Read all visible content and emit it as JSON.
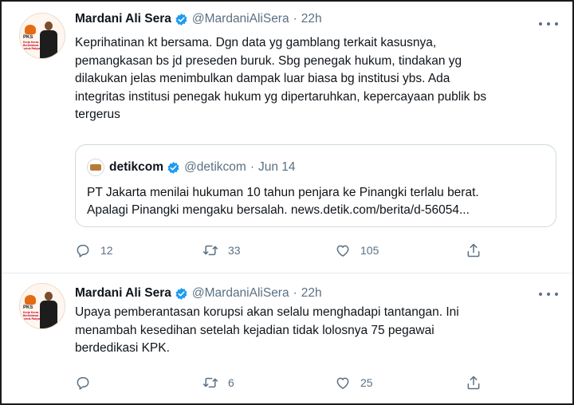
{
  "tweets": [
    {
      "author": {
        "name": "Mardani Ali Sera",
        "handle": "@MardaniAliSera",
        "time": "22h"
      },
      "avatar_text": [
        "PKS",
        "Kerja Keras Berkhidmat untuk Rakyat"
      ],
      "text": "Keprihatinan kt bersama. Dgn data yg gamblang terkait kasusnya,\npemangkasan bs jd preseden buruk. Sbg penegak hukum, tindakan yg\ndilakukan jelas menimbulkan dampak luar biasa bg institusi ybs. Ada\nintegritas institusi penegak hukum yg dipertaruhkan, kepercayaan publik bs\ntergerus",
      "quote": {
        "name": "detikcom",
        "handle": "@detikcom",
        "date": "Jun 14",
        "text": "PT Jakarta menilai hukuman 10 tahun penjara ke Pinangki terlalu berat.\nApalagi Pinangki mengaku bersalah. news.detik.com/berita/d-56054..."
      },
      "actions": {
        "replies": "12",
        "retweets": "33",
        "likes": "105"
      }
    },
    {
      "author": {
        "name": "Mardani Ali Sera",
        "handle": "@MardaniAliSera",
        "time": "22h"
      },
      "avatar_text": [
        "PKS",
        "Kerja Keras Berkhidmat untuk Rakyat"
      ],
      "text": "Upaya pemberantasan korupsi akan selalu menghadapi tantangan. Ini\nmenambah kesedihan setelah kejadian tidak lolosnya 75 pegawai\nberdedikasi KPK.",
      "actions": {
        "replies": "",
        "retweets": "6",
        "likes": "25"
      }
    }
  ],
  "colors": {
    "verified": "#1d9bf0",
    "secondary_text": "#5b7083",
    "divider": "#e6ecf0",
    "avatar_accent": "#e66a12"
  },
  "icons": [
    "verified-badge-icon",
    "more-icon",
    "reply-icon",
    "retweet-icon",
    "like-icon",
    "share-icon"
  ]
}
